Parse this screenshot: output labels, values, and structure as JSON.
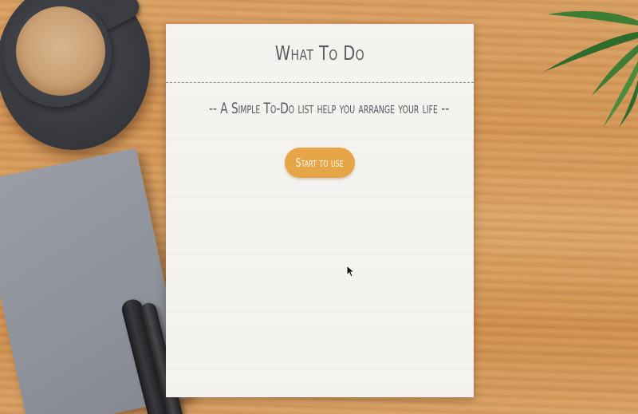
{
  "app": {
    "title": "What To Do",
    "tagline": "-- A Simple To-Do list help you arrange your life --",
    "start_button_label": "Start to use"
  },
  "colors": {
    "button_bg": "#e6a547",
    "text": "#5c5c60",
    "paper": "#f6f4f1"
  },
  "icons": {
    "cursor": "mouse-pointer"
  }
}
